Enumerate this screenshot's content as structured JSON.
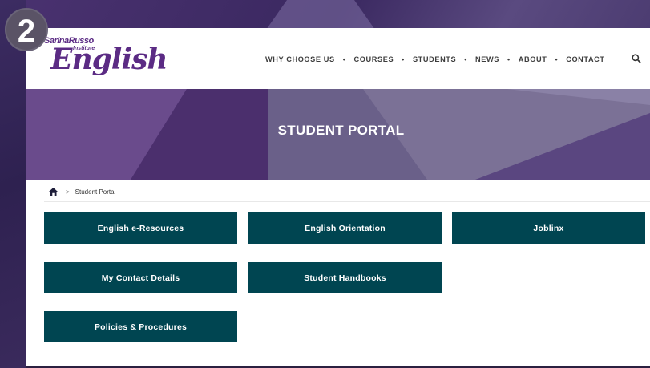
{
  "step_badge": "2",
  "logo": {
    "brand_line": "SarinaRusso",
    "institute": "Institute",
    "wordmark": "English"
  },
  "nav": {
    "items": [
      "WHY CHOOSE US",
      "COURSES",
      "STUDENTS",
      "NEWS",
      "ABOUT",
      "CONTACT"
    ],
    "separator": "•"
  },
  "hero": {
    "title": "STUDENT PORTAL"
  },
  "breadcrumb": {
    "separator": ">",
    "current": "Student Portal"
  },
  "tiles": [
    {
      "label": "English e-Resources"
    },
    {
      "label": "English Orientation"
    },
    {
      "label": "Joblinx"
    },
    {
      "label": "My Contact Details"
    },
    {
      "label": "Student Handbooks"
    },
    {
      "label": "Policies & Procedures"
    }
  ],
  "colors": {
    "brand_purple": "#5b2b84",
    "tile_teal": "#004551",
    "hero_purple": "#4e3572"
  },
  "icons": {
    "search": "search-icon",
    "home": "home-icon"
  }
}
